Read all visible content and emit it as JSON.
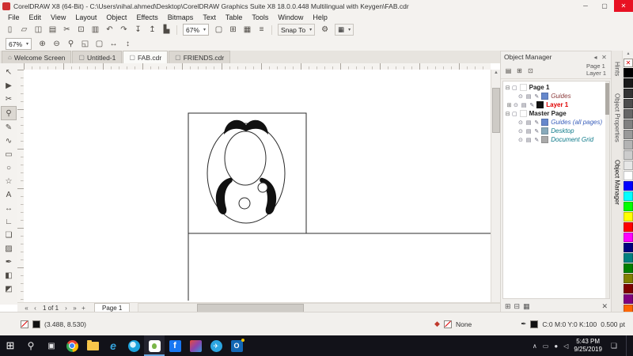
{
  "titlebar": {
    "title": "CorelDRAW X8 (64-Bit) - C:\\Users\\nihal.ahmed\\Desktop\\CorelDRAW Graphics Suite X8 18.0.0.448 Multilingual with Keygen\\FAB.cdr",
    "minimize": "─",
    "maximize": "▢",
    "close": "✕"
  },
  "menubar": {
    "items": [
      "File",
      "Edit",
      "View",
      "Layout",
      "Object",
      "Effects",
      "Bitmaps",
      "Text",
      "Table",
      "Tools",
      "Window",
      "Help"
    ]
  },
  "toolbar_main": {
    "icons": [
      {
        "name": "new-document-icon",
        "glyph": "▯"
      },
      {
        "name": "open-icon",
        "glyph": "▱"
      },
      {
        "name": "save-icon",
        "glyph": "◫"
      },
      {
        "name": "print-icon",
        "glyph": "▤"
      },
      {
        "name": "cut-icon",
        "glyph": "✂"
      },
      {
        "name": "copy-icon",
        "glyph": "⊡"
      },
      {
        "name": "paste-icon",
        "glyph": "▥"
      },
      {
        "name": "undo-icon",
        "glyph": "↶"
      },
      {
        "name": "redo-icon",
        "glyph": "↷"
      },
      {
        "name": "import-icon",
        "glyph": "↧"
      },
      {
        "name": "export-icon",
        "glyph": "↥"
      },
      {
        "name": "publish-pdf-icon",
        "glyph": "▙"
      }
    ],
    "zoom_value": "67%",
    "view_icons": [
      {
        "name": "fullscreen-preview-icon",
        "glyph": "▢"
      },
      {
        "name": "show-rulers-icon",
        "glyph": "⊞"
      },
      {
        "name": "show-grid-icon",
        "glyph": "▦"
      },
      {
        "name": "show-guidelines-icon",
        "glyph": "≡"
      }
    ],
    "snap_label": "Snap To",
    "options_glyph": "⚙",
    "launcher_glyph": "▦"
  },
  "toolbar_zoom": {
    "zoom_value": "67%",
    "icons": [
      {
        "name": "zoom-in-icon",
        "glyph": "⊕"
      },
      {
        "name": "zoom-out-icon",
        "glyph": "⊖"
      },
      {
        "name": "zoom-selected-icon",
        "glyph": "⚲"
      },
      {
        "name": "zoom-all-objects-icon",
        "glyph": "◱"
      },
      {
        "name": "zoom-page-icon",
        "glyph": "▢"
      },
      {
        "name": "zoom-page-width-icon",
        "glyph": "↔"
      },
      {
        "name": "zoom-page-height-icon",
        "glyph": "↕"
      }
    ]
  },
  "document_tabs": [
    {
      "icon": "⌂",
      "label": "Welcome Screen"
    },
    {
      "icon": "▢",
      "label": "Untitled-1"
    },
    {
      "icon": "▢",
      "label": "FAB.cdr",
      "state": "active"
    },
    {
      "icon": "▢",
      "label": "FRIENDS.cdr"
    }
  ],
  "toolbox": [
    {
      "name": "pick-tool",
      "glyph": "↖"
    },
    {
      "name": "shape-tool",
      "glyph": "▶"
    },
    {
      "name": "crop-tool",
      "glyph": "✂"
    },
    {
      "name": "zoom-tool",
      "glyph": "⚲",
      "state": "active"
    },
    {
      "name": "freehand-tool",
      "glyph": "✎"
    },
    {
      "name": "artistic-media-tool",
      "glyph": "∿"
    },
    {
      "name": "rectangle-tool",
      "glyph": "▭"
    },
    {
      "name": "ellipse-tool",
      "glyph": "○"
    },
    {
      "name": "polygon-tool",
      "glyph": "☆"
    },
    {
      "name": "text-tool",
      "glyph": "A"
    },
    {
      "name": "dimension-tool",
      "glyph": "↔"
    },
    {
      "name": "connector-tool",
      "glyph": "∟"
    },
    {
      "name": "drop-shadow-tool",
      "glyph": "❏"
    },
    {
      "name": "transparency-tool",
      "glyph": "▨"
    },
    {
      "name": "eyedropper-tool",
      "glyph": "✒"
    },
    {
      "name": "interactive-fill-tool",
      "glyph": "◧"
    },
    {
      "name": "smart-fill-tool",
      "glyph": "◩"
    }
  ],
  "object_manager": {
    "title": "Object Manager",
    "collapse_glyph": "◂",
    "close_glyph": "✕",
    "toolbar_icons": [
      {
        "name": "show-object-properties-icon",
        "glyph": "▤"
      },
      {
        "name": "edit-across-layers-icon",
        "glyph": "⊞"
      },
      {
        "name": "layer-manager-view-icon",
        "glyph": "⊡"
      }
    ],
    "page_label": "Page 1",
    "layer_label": "Layer 1",
    "tree": [
      {
        "exp": "⊟",
        "glyphs": "▢",
        "label": "Page 1",
        "weight": "bold",
        "color": "#222222",
        "pad": "2px"
      },
      {
        "exp": "",
        "glyphs": "⊙ ▤ ✎",
        "chip": "#6688cc",
        "label": "Guides",
        "color": "#8b3a3a",
        "style": "italic",
        "pad": "10px"
      },
      {
        "exp": "⊞",
        "glyphs": "⊙ ▤ ✎",
        "chip": "#111111",
        "label": "Layer 1",
        "color": "#e00000",
        "weight": "bold",
        "pad": "4px"
      },
      {
        "exp": "⊟",
        "glyphs": "▢",
        "label": "Master Page",
        "weight": "bold",
        "color": "#222222",
        "pad": "2px"
      },
      {
        "exp": "",
        "glyphs": "⊙ ▤ ✎",
        "chip": "#6688cc",
        "label": "Guides (all pages)",
        "color": "#3a5fbb",
        "style": "italic",
        "pad": "10px"
      },
      {
        "exp": "",
        "glyphs": "⊙ ▤ ✎",
        "chip": "#88aabb",
        "label": "Desktop",
        "color": "#0e7a8a",
        "style": "italic",
        "pad": "10px"
      },
      {
        "exp": "",
        "glyphs": "⊙ ▤ ✎",
        "chip": "#aaaaaa",
        "label": "Document Grid",
        "color": "#0e7a8a",
        "style": "italic",
        "pad": "10px"
      }
    ],
    "bottom_icons": [
      {
        "name": "new-layer-button",
        "glyph": "⊞"
      },
      {
        "name": "new-master-layer-button",
        "glyph": "⊟"
      },
      {
        "name": "edit-layer-button",
        "glyph": "▦"
      }
    ],
    "delete_glyph": "✕"
  },
  "docker_tabs": [
    {
      "label": "Hints"
    },
    {
      "label": "Object Properties"
    },
    {
      "label": "Object Manager",
      "state": "active"
    }
  ],
  "palette": {
    "up_glyph": "▴",
    "none_glyph": "✕",
    "down_glyph": "▾",
    "colors": [
      "#000000",
      "#1a1a1a",
      "#333333",
      "#4d4d4d",
      "#666666",
      "#808080",
      "#999999",
      "#b3b3b3",
      "#cccccc",
      "#e6e6e6",
      "#ffffff",
      "#0000ff",
      "#00ffff",
      "#00ff00",
      "#ffff00",
      "#ff0000",
      "#ff00ff",
      "#000080",
      "#008080",
      "#008000",
      "#808000",
      "#800000",
      "#800080",
      "#ff6600"
    ]
  },
  "pagebar": {
    "first_glyph": "«",
    "prev_glyph": "‹",
    "counter": "1 of 1",
    "next_glyph": "›",
    "last_glyph": "»",
    "add_glyph": "+",
    "page_tab": "Page 1"
  },
  "statusbar": {
    "coords": "(3.488, 8.530)",
    "fill_icon_glyph": "◆",
    "fill_label": "None",
    "outline_pen_glyph": "✒",
    "outline_values": "C:0 M:0 Y:0 K:100",
    "outline_width": "0.500 pt"
  },
  "taskbar": {
    "apps": [
      {
        "name": "start-button",
        "kind": "start",
        "glyph": "⊞"
      },
      {
        "name": "search-icon",
        "kind": "search",
        "glyph": "⚲"
      },
      {
        "name": "task-view-icon",
        "kind": "taskview",
        "glyph": "▣"
      },
      {
        "name": "chrome-icon",
        "kind": "chrome",
        "glyph": ""
      },
      {
        "name": "file-explorer-icon",
        "kind": "folder",
        "glyph": ""
      },
      {
        "name": "edge-icon",
        "kind": "edge",
        "glyph": "e"
      },
      {
        "name": "browser-icon",
        "kind": "compass",
        "glyph": ""
      },
      {
        "name": "coreldraw-icon",
        "kind": "corel",
        "glyph": "",
        "state": "active"
      },
      {
        "name": "facebook-icon",
        "kind": "facebook",
        "glyph": "f"
      },
      {
        "name": "photos-icon",
        "kind": "photos",
        "glyph": ""
      },
      {
        "name": "telegram-icon",
        "kind": "telegram",
        "glyph": "✈"
      },
      {
        "name": "outlook-icon",
        "kind": "outlook",
        "glyph": "O"
      }
    ],
    "tray_icons": [
      {
        "name": "tray-chevron-icon",
        "glyph": "∧"
      },
      {
        "name": "battery-icon",
        "glyph": "▭"
      },
      {
        "name": "network-icon",
        "glyph": "●"
      },
      {
        "name": "volume-icon",
        "glyph": "◁"
      }
    ],
    "clock": {
      "time": "5:43 PM",
      "date": "9/25/2019"
    },
    "notification_glyph": "❏"
  }
}
